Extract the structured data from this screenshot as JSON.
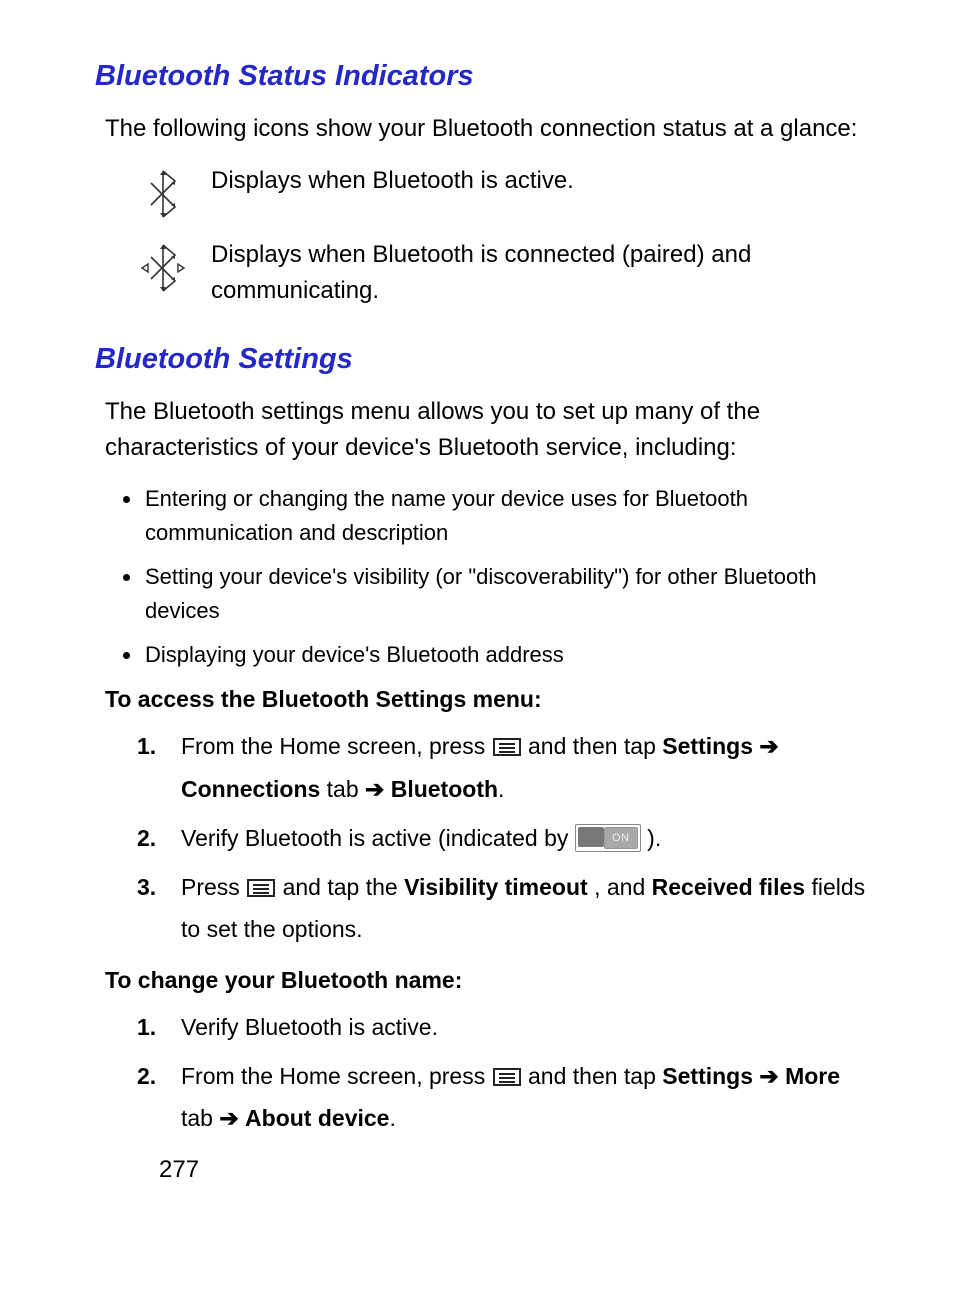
{
  "sections": {
    "indicators": {
      "title": "Bluetooth Status Indicators",
      "intro": "The following icons show your Bluetooth connection status at a glance:",
      "rows": [
        {
          "icon": "bluetooth-active-icon",
          "desc": "Displays when Bluetooth is active."
        },
        {
          "icon": "bluetooth-connected-icon",
          "desc": "Displays when Bluetooth is connected (paired) and communicating."
        }
      ]
    },
    "settings": {
      "title": "Bluetooth Settings",
      "intro": "The Bluetooth settings menu allows you to set up many of the characteristics of your device's Bluetooth service, including:",
      "bullets": [
        "Entering or changing the name your device uses for Bluetooth communication and description",
        "Setting your device's visibility (or \"discoverability\") for other Bluetooth devices",
        "Displaying your device's Bluetooth address"
      ],
      "access_heading": "To access the Bluetooth Settings menu:",
      "access_steps": {
        "s1_pre": "From the Home screen, press ",
        "s1_mid": " and then tap ",
        "s1_settings": "Settings",
        "s1_conn": "Connections",
        "s1_tab": " tab ",
        "s1_bt": "Bluetooth",
        "s2_pre": "Verify Bluetooth is active (indicated by  ",
        "s2_post": " ).",
        "s3_pre": "Press ",
        "s3_mid": " and tap the ",
        "s3_vt": "Visibility timeout",
        "s3_and": ", and ",
        "s3_rf": "Received files",
        "s3_post": " fields to set the options."
      },
      "change_heading": "To change your Bluetooth name:",
      "change_steps": {
        "s1": "Verify Bluetooth is active.",
        "s2_pre": "From the Home screen, press ",
        "s2_mid": " and then tap ",
        "s2_settings": "Settings",
        "s2_more": "More",
        "s2_tab": " tab ",
        "s2_about": "About device"
      }
    }
  },
  "toggle_label": "ON",
  "page_number": "277"
}
